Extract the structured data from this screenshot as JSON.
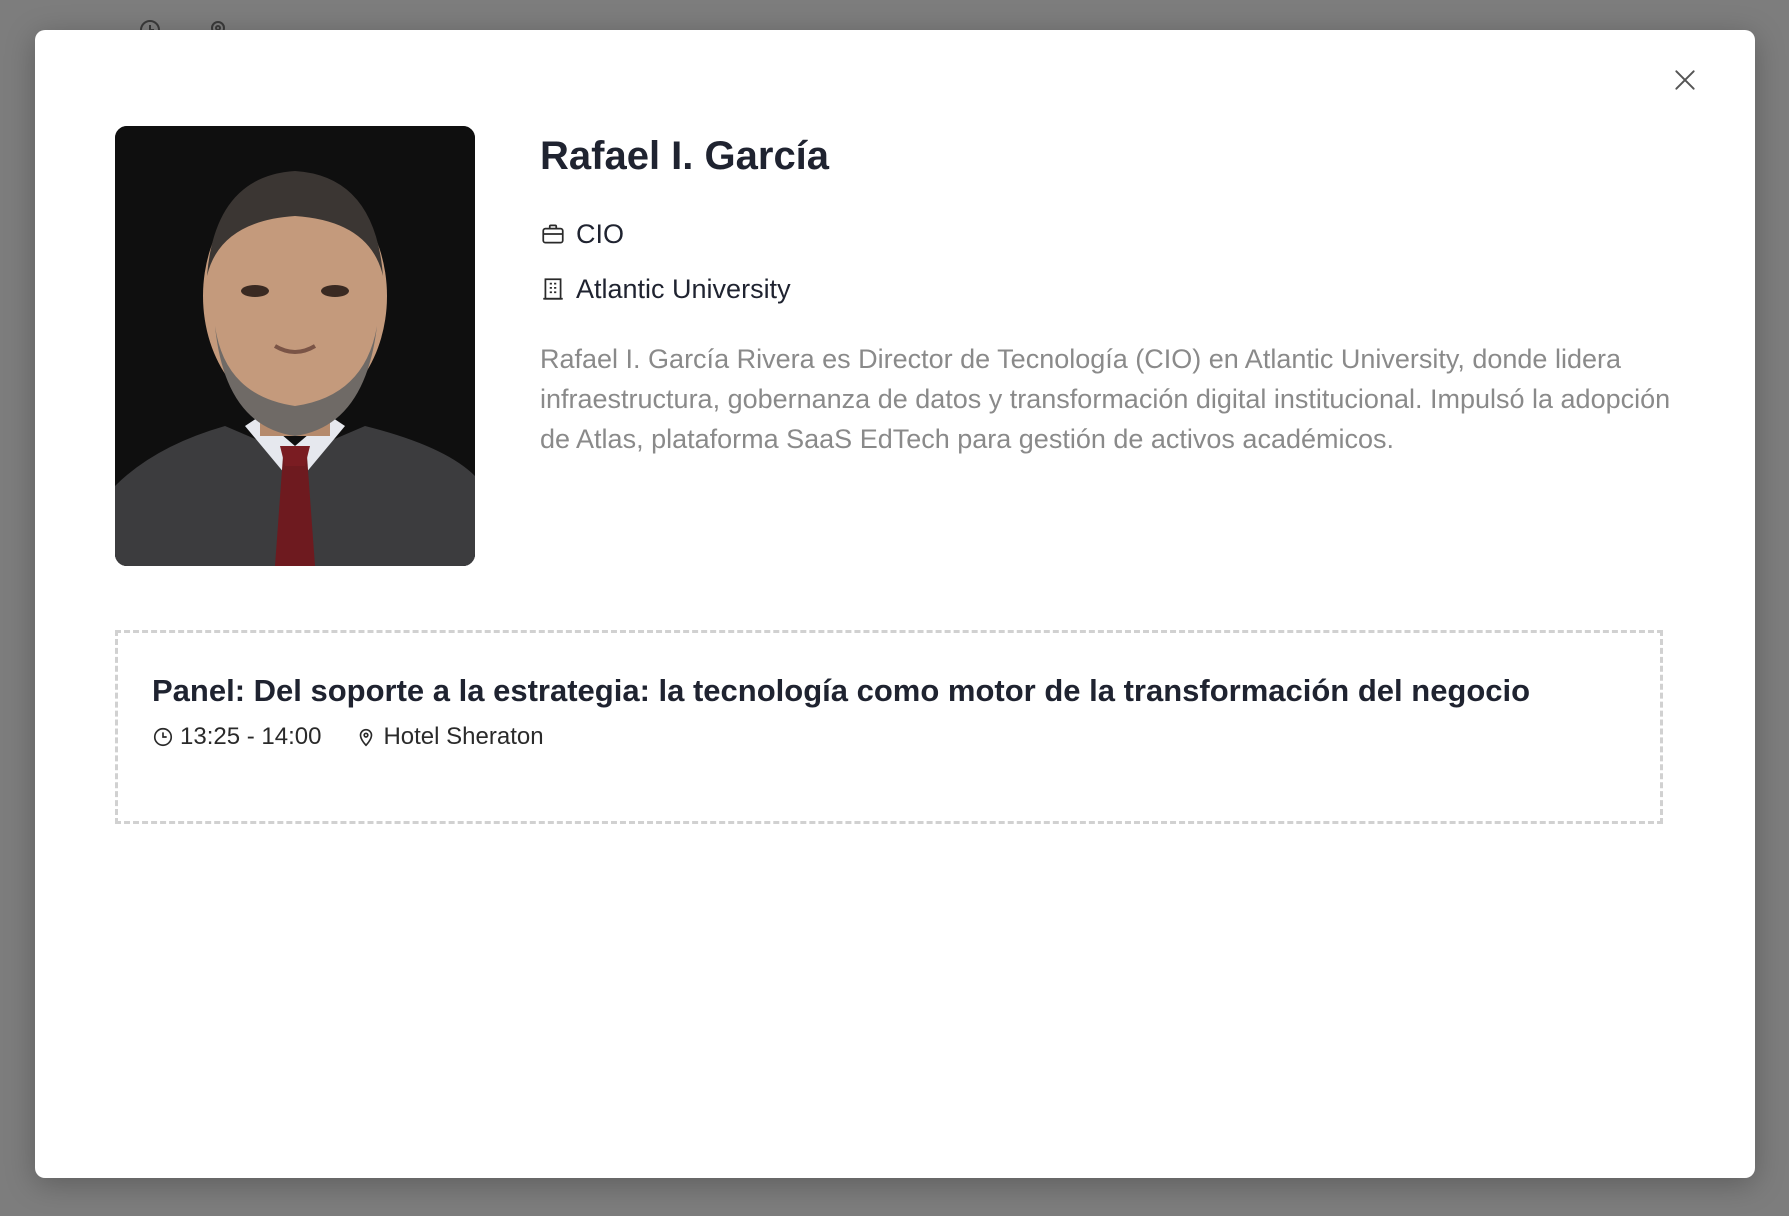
{
  "speaker": {
    "name": "Rafael I. García",
    "job_title": "CIO",
    "organization": "Atlantic University",
    "bio": "Rafael I. García Rivera es Director de Tecnología (CIO) en Atlantic University, donde lidera infraestructura, gobernanza de datos y transformación digital institucional. Impulsó la adopción de Atlas, plataforma SaaS EdTech para gestión de activos académicos."
  },
  "session": {
    "title": "Panel: Del soporte a la estrategia: la tecnología como motor de la transformación del negocio",
    "time": "13:25 - 14:00",
    "location": "Hotel Sheraton"
  },
  "icons": {
    "close": "close-icon",
    "job": "briefcase-icon",
    "organization": "building-icon",
    "time": "clock-icon",
    "location": "map-pin-icon"
  },
  "colors": {
    "overlay": "#7d7d7d",
    "modal_bg": "#ffffff",
    "text_primary": "#1f2330",
    "text_muted": "#8a8a8a",
    "dashed_border": "#d1d1d1"
  }
}
